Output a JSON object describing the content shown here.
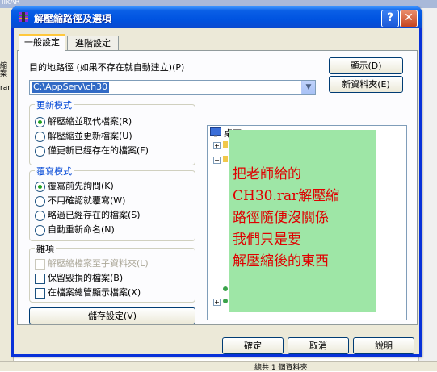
{
  "background_app": {
    "title_fragment": "likAR",
    "left_fragments": [
      "縮",
      "案",
      "rar"
    ],
    "status_fragment": "總共 1 個資料夾"
  },
  "dialog": {
    "title": "解壓縮路徑及選項",
    "help_symbol": "?",
    "close_symbol": "✕",
    "tabs": [
      {
        "label": "一般設定",
        "active": true
      },
      {
        "label": "進階設定",
        "active": false
      }
    ],
    "destination": {
      "label": "目的地路徑 (如果不存在就自動建立)(P)",
      "value": "C:\\AppServ\\ch30",
      "combo_arrow": "▼"
    },
    "show_button": "顯示(D)",
    "new_folder_button": "新資料夾(E)",
    "update_mode": {
      "title": "更新模式",
      "options": [
        {
          "label": "解壓縮並取代檔案(R)",
          "selected": true
        },
        {
          "label": "解壓縮並更新檔案(U)",
          "selected": false
        },
        {
          "label": "僅更新已經存在的檔案(F)",
          "selected": false
        }
      ]
    },
    "overwrite_mode": {
      "title": "覆寫模式",
      "options": [
        {
          "label": "覆寫前先詢問(K)",
          "selected": true
        },
        {
          "label": "不用確認就覆寫(W)",
          "selected": false
        },
        {
          "label": "略過已經存在的檔案(S)",
          "selected": false
        },
        {
          "label": "自動重新命名(N)",
          "selected": false
        }
      ]
    },
    "misc": {
      "title": "雜項",
      "options": [
        {
          "label": "解壓縮檔案至子資料夾(L)",
          "checked": false,
          "disabled": true
        },
        {
          "label": "保留毀損的檔案(B)",
          "checked": false,
          "disabled": false
        },
        {
          "label": "在檔案總管顯示檔案(X)",
          "checked": false,
          "disabled": false
        }
      ]
    },
    "save_settings_button": "儲存設定(V)",
    "tree": {
      "root_label": "桌面",
      "expander_plus": "+",
      "expander_minus": "−"
    },
    "note_lines": [
      "把老師給的",
      "CH30.rar解壓縮",
      "路徑隨便沒關係",
      "我們只是要",
      "解壓縮後的東西"
    ],
    "ok_button": "確定",
    "cancel_button": "取消",
    "help_button": "說明"
  },
  "colors": {
    "titlebar": "#0053e0",
    "note_background": "#9ee6a6",
    "note_text": "#e00000",
    "group_title": "#0046d5"
  }
}
